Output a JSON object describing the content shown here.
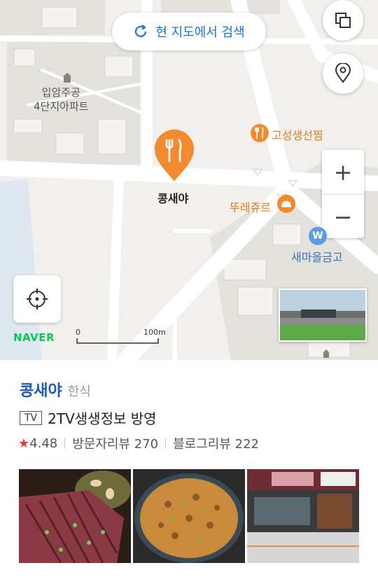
{
  "map": {
    "search_here_label": "현 지도에서 검색",
    "labels": {
      "apartment": [
        "입암주공",
        "4단지아파트"
      ],
      "poi_goseong": "고성생선찜",
      "poi_ttore": "뚜레쥬르",
      "poi_saemaeul": "새마을금고",
      "selected_place": "콩새야"
    },
    "naver_logo": "NAVER",
    "scale": {
      "start": "0",
      "end": "100m"
    },
    "zoom_in": "+",
    "zoom_out": "−",
    "colors": {
      "accent": "#1a73d9",
      "food_pin": "#f28b30",
      "naver_green": "#03c75a"
    }
  },
  "panel": {
    "place_name": "콩새야",
    "category": "한식",
    "tv_badge": "TV",
    "tv_text": "2TV생생정보 방영",
    "rating": "4.48",
    "visitor_reviews": "방문자리뷰 270",
    "blog_reviews": "블로그리뷰 222",
    "photos": [
      "grilled-beef-photo",
      "fried-rice-pan-photo",
      "storefront-photo"
    ]
  }
}
